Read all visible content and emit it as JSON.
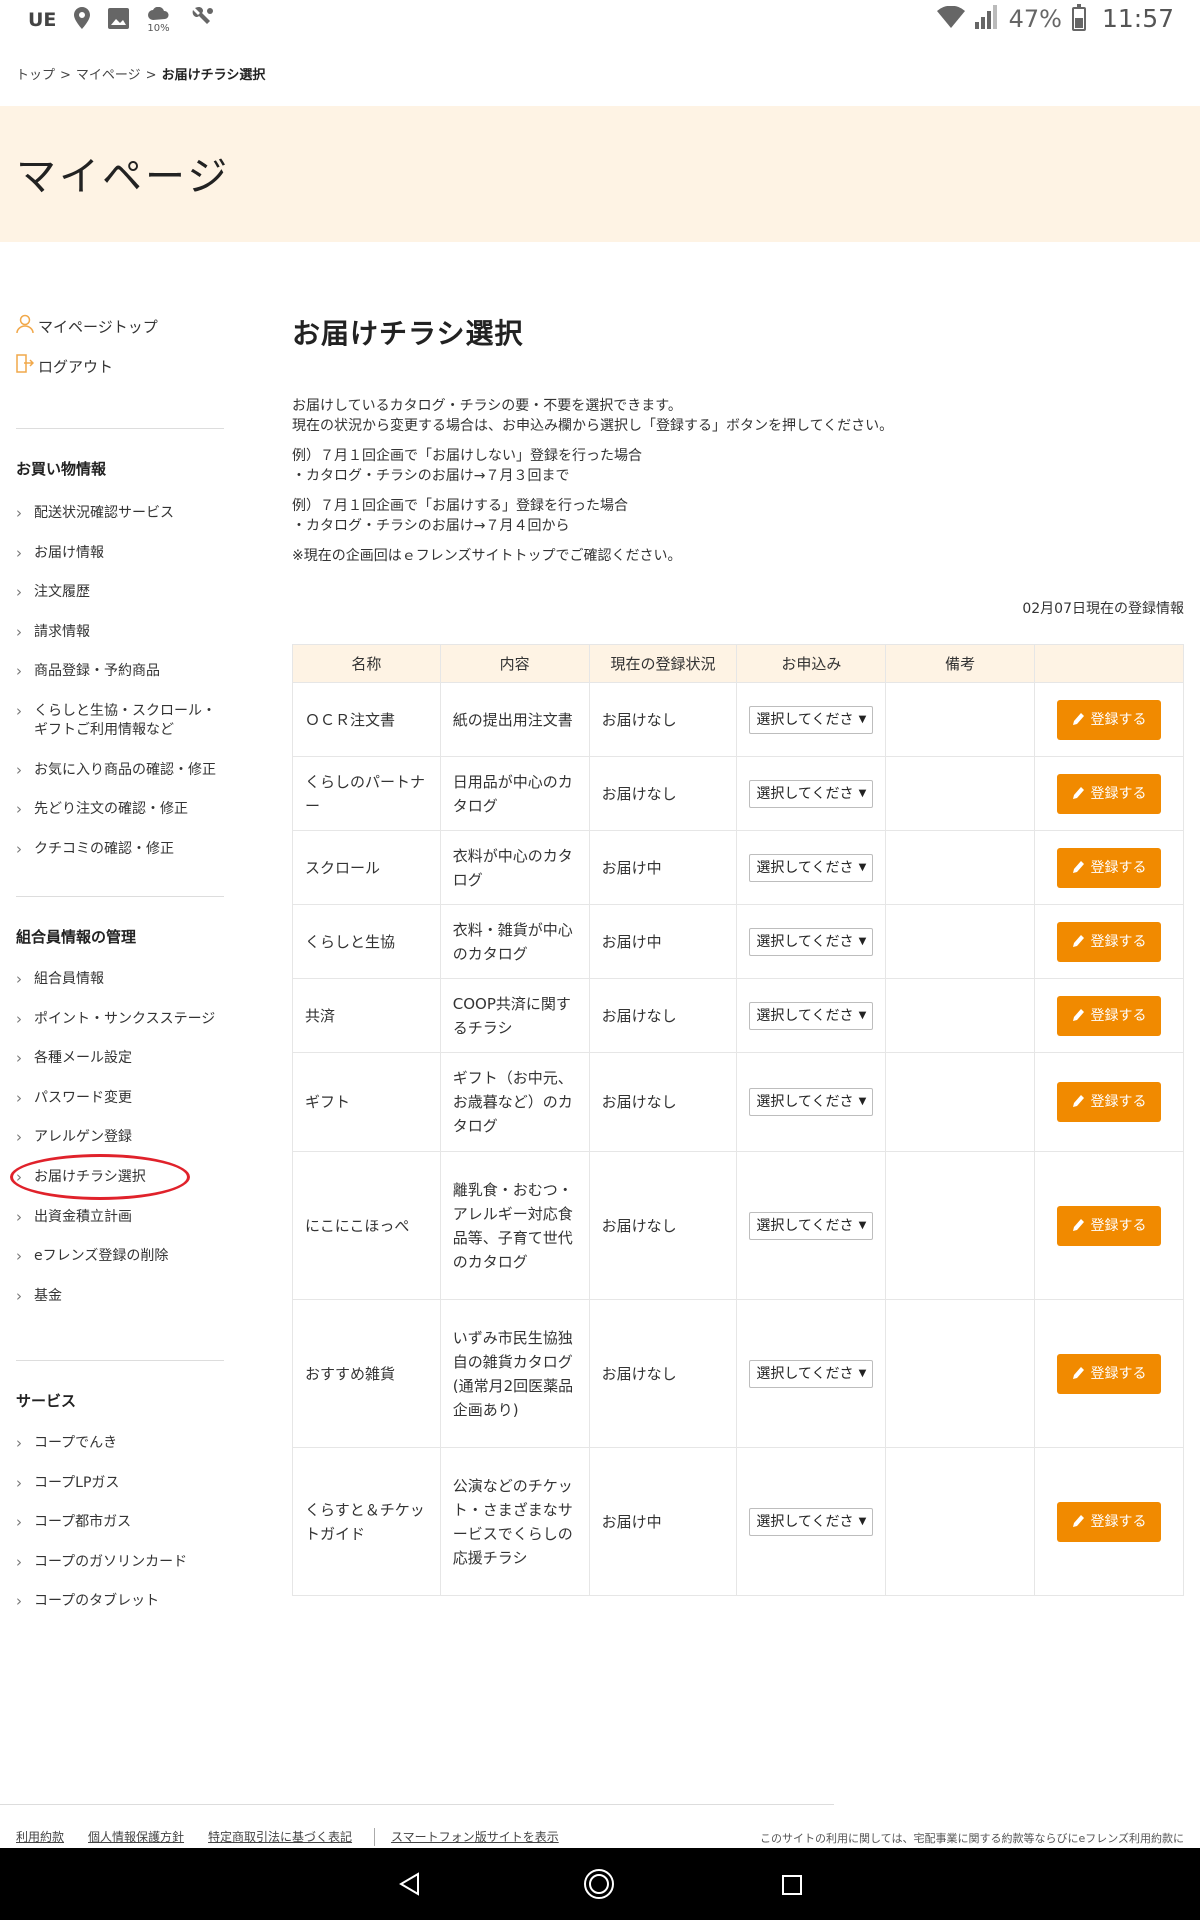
{
  "status_bar": {
    "carrier": "UE",
    "weather_pct": "10%",
    "battery_pct": "47%",
    "battery_level": 0.47,
    "time": "11:57"
  },
  "breadcrumb": {
    "top": "トップ",
    "mypage": "マイページ",
    "current": "お届けチラシ選択",
    "separator": ">"
  },
  "banner": {
    "title": "マイページ"
  },
  "sidebar": {
    "mypage_top": "マイページトップ",
    "logout": "ログアウト",
    "sections": [
      {
        "heading": "お買い物情報",
        "items": [
          "配送状況確認サービス",
          "お届け情報",
          "注文履歴",
          "請求情報",
          "商品登録・予約商品",
          "くらしと生協・スクロール・ギフトご利用情報など",
          "お気に入り商品の確認・修正",
          "先どり注文の確認・修正",
          "クチコミの確認・修正"
        ]
      },
      {
        "heading": "組合員情報の管理",
        "items": [
          "組合員情報",
          "ポイント・サンクスステージ",
          "各種メール設定",
          "パスワード変更",
          "アレルゲン登録",
          "お届けチラシ選択",
          "出資金積立計画",
          "eフレンズ登録の削除",
          "基金"
        ]
      },
      {
        "heading": "サービス",
        "items": [
          "コープでんき",
          "コープLPガス",
          "コープ都市ガス",
          "コープのガソリンカード",
          "コープのタブレット"
        ]
      }
    ]
  },
  "main": {
    "title": "お届けチラシ選択",
    "desc1": "お届けしているカタログ・チラシの要・不要を選択できます。",
    "desc2": "現在の状況から変更する場合は、お申込み欄から選択し「登録する」ボタンを押してください。",
    "ex1a": "例）７月１回企画で「お届けしない」登録を行った場合",
    "ex1b": "・カタログ・チラシのお届け→７月３回まで",
    "ex2a": "例）７月１回企画で「お届けする」登録を行った場合",
    "ex2b": "・カタログ・チラシのお届け→７月４回から",
    "note": "※現在の企画回はｅフレンズサイトトップでご確認ください。",
    "as_of": "02月07日現在の登録情報"
  },
  "table": {
    "headers": [
      "名称",
      "内容",
      "現在の登録状況",
      "お申込み",
      "備考",
      ""
    ],
    "select_placeholder": "選択してくださ",
    "button_label": "登録する",
    "rows": [
      {
        "name": "ＯＣＲ注文書",
        "content": "紙の提出用注文書",
        "status": "お届けなし",
        "note": ""
      },
      {
        "name": "くらしのパートナー",
        "content": "日用品が中心のカタログ",
        "status": "お届けなし",
        "note": ""
      },
      {
        "name": "スクロール",
        "content": "衣料が中心のカタログ",
        "status": "お届け中",
        "note": ""
      },
      {
        "name": "くらしと生協",
        "content": "衣料・雑貨が中心のカタログ",
        "status": "お届け中",
        "note": ""
      },
      {
        "name": "共済",
        "content": "COOP共済に関するチラシ",
        "status": "お届けなし",
        "note": ""
      },
      {
        "name": "ギフト",
        "content": "ギフト（お中元、お歳暮など）のカタログ",
        "status": "お届けなし",
        "note": ""
      },
      {
        "name": "にこにこほっぺ",
        "content": "離乳食・おむつ・アレルギー対応食品等、子育て世代のカタログ",
        "status": "お届けなし",
        "note": ""
      },
      {
        "name": "おすすめ雑貨",
        "content": "いずみ市民生協独自の雑貨カタログ(通常月2回医薬品企画あり)",
        "status": "お届けなし",
        "note": ""
      },
      {
        "name": "くらすと＆チケットガイド",
        "content": "公演などのチケット・さまざまなサービスでくらしの応援チラシ",
        "status": "お届け中",
        "note": ""
      }
    ]
  },
  "footer": {
    "links": [
      "利用約款",
      "個人情報保護方針",
      "特定商取引法に基づく表記"
    ],
    "smartphone_link": "スマートフォン版サイトを表示",
    "note": "このサイトの利用に関しては、宅配事業に関する約款等ならびにeフレンズ利用約款に"
  },
  "colors": {
    "accent": "#f18a00",
    "banner_bg": "#fef3e4",
    "highlight_ring": "#e0222b"
  },
  "icons": [
    "person-icon",
    "logout-icon",
    "pencil-icon",
    "location-icon",
    "image-icon",
    "wifi-icon",
    "signal-icon",
    "battery-icon",
    "nav-back-icon",
    "nav-home-icon",
    "nav-recent-icon"
  ]
}
